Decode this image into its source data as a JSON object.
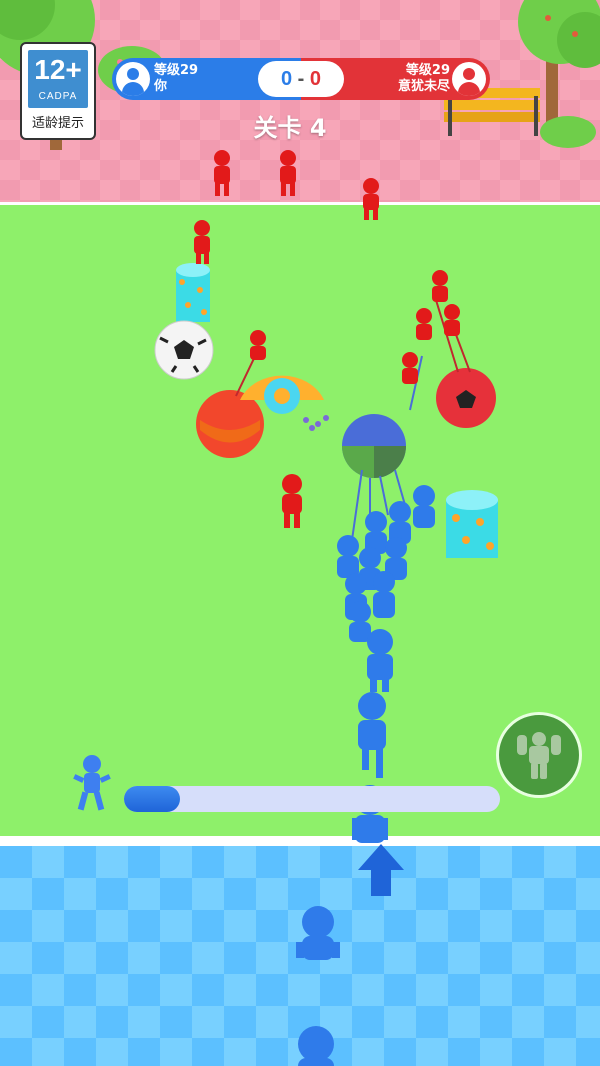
{
  "age_rating": {
    "number": "12+",
    "org": "CADPA",
    "text": "适龄提示"
  },
  "scoreboard": {
    "player": {
      "level": "等级29",
      "name": "你"
    },
    "opponent": {
      "level": "等级29",
      "name": "意犹未尽"
    },
    "score_left": "0",
    "separator": "-",
    "score_right": "0"
  },
  "level_title": "关卡 4",
  "progress": {
    "fraction": 0.15
  },
  "colors": {
    "team_blue": "#2f7bea",
    "team_red": "#e21a1a",
    "field": "#8ef06a"
  },
  "icons": {
    "power": "strongman-icon",
    "move": "up-arrow-icon",
    "runner": "runner-icon"
  }
}
